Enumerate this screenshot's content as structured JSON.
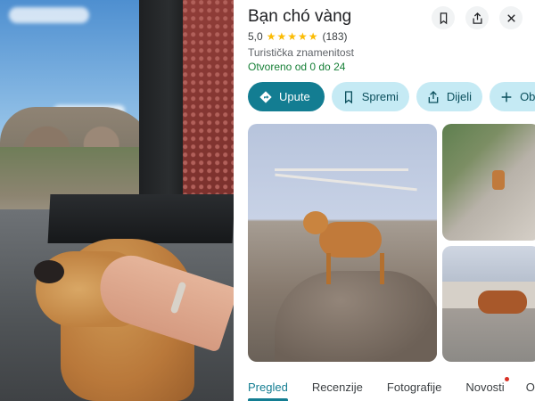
{
  "place": {
    "name": "Bạn chó vàng",
    "rating": "5,0",
    "stars": "★★★★★",
    "reviews_count": "(183)",
    "category": "Turistička znamenitost",
    "hours_status": "Otvoreno od 0 do 24",
    "colors": {
      "accent": "#137d92",
      "open": "#188038",
      "star": "#fbbc04"
    }
  },
  "header_buttons": [
    {
      "icon": "bookmark-icon"
    },
    {
      "icon": "share-icon"
    },
    {
      "icon": "close-icon"
    }
  ],
  "actions": [
    {
      "label": "Upute",
      "icon": "directions-icon"
    },
    {
      "label": "Spremi",
      "icon": "bookmark-icon"
    },
    {
      "label": "Dijeli",
      "icon": "share-icon"
    },
    {
      "label": "Obj",
      "icon": "plus-icon"
    }
  ],
  "tabs": [
    {
      "label": "Pregled",
      "active": true
    },
    {
      "label": "Recenzije"
    },
    {
      "label": "Fotografije"
    },
    {
      "label": "Novosti",
      "notification_dot": true
    },
    {
      "label": "O m"
    }
  ]
}
